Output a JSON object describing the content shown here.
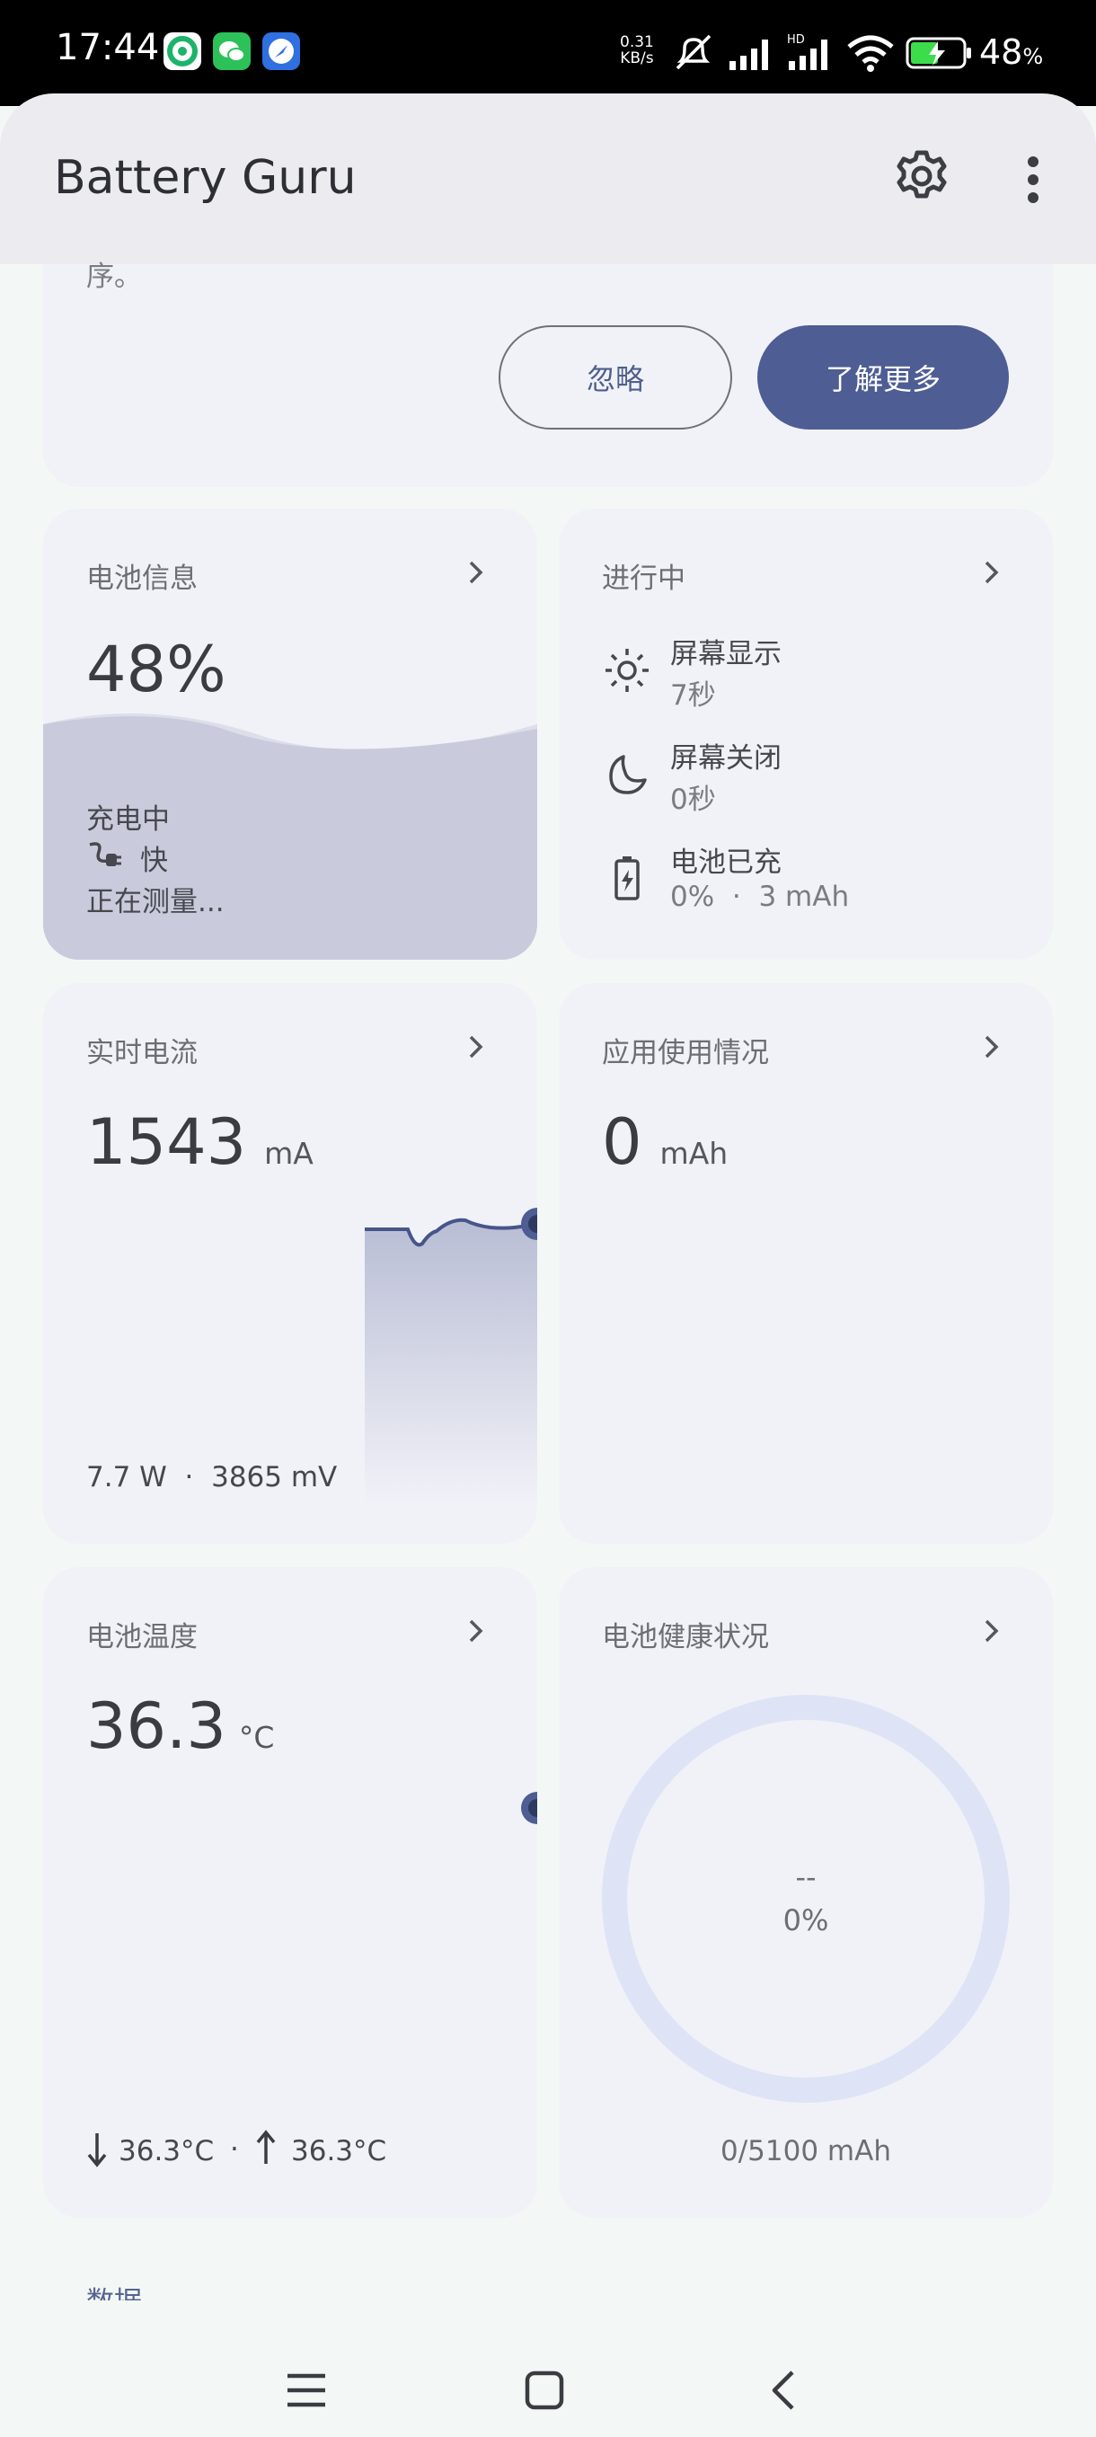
{
  "status": {
    "time": "17:44",
    "net_speed_value": "0.31",
    "net_speed_unit": "KB/s",
    "battery_percent": "48",
    "battery_percent_sign": "%"
  },
  "appbar": {
    "title": "Battery Guru"
  },
  "banner": {
    "text_tail": "序。",
    "ignore_label": "忽略",
    "learn_more_label": "了解更多"
  },
  "battery_info": {
    "title": "电池信息",
    "percent": "48%",
    "level": 0.48,
    "state": "充电中",
    "speed": "快",
    "measuring": "正在测量..."
  },
  "ongoing": {
    "title": "进行中",
    "screen_on_label": "屏幕显示",
    "screen_on_value": "7秒",
    "screen_off_label": "屏幕关闭",
    "screen_off_value": "0秒",
    "charged_label": "电池已充",
    "charged_pct": "0%",
    "charged_sep": "·",
    "charged_mah": "3 mAh"
  },
  "realtime_current": {
    "title": "实时电流",
    "value": "1543",
    "unit": "mA",
    "watts": "7.7 W",
    "sep": "·",
    "millivolts": "3865 mV"
  },
  "app_usage": {
    "title": "应用使用情况",
    "value": "0",
    "unit": "mAh"
  },
  "battery_temp": {
    "title": "电池温度",
    "value": "36.3",
    "unit": "°C",
    "min": "36.3°C",
    "sep": "·",
    "max": "36.3°C"
  },
  "battery_health": {
    "title": "电池健康状况",
    "health_value": "--",
    "health_percent": "0%",
    "capacity": "0/5100 mAh"
  },
  "section": {
    "data_label": "数据"
  }
}
